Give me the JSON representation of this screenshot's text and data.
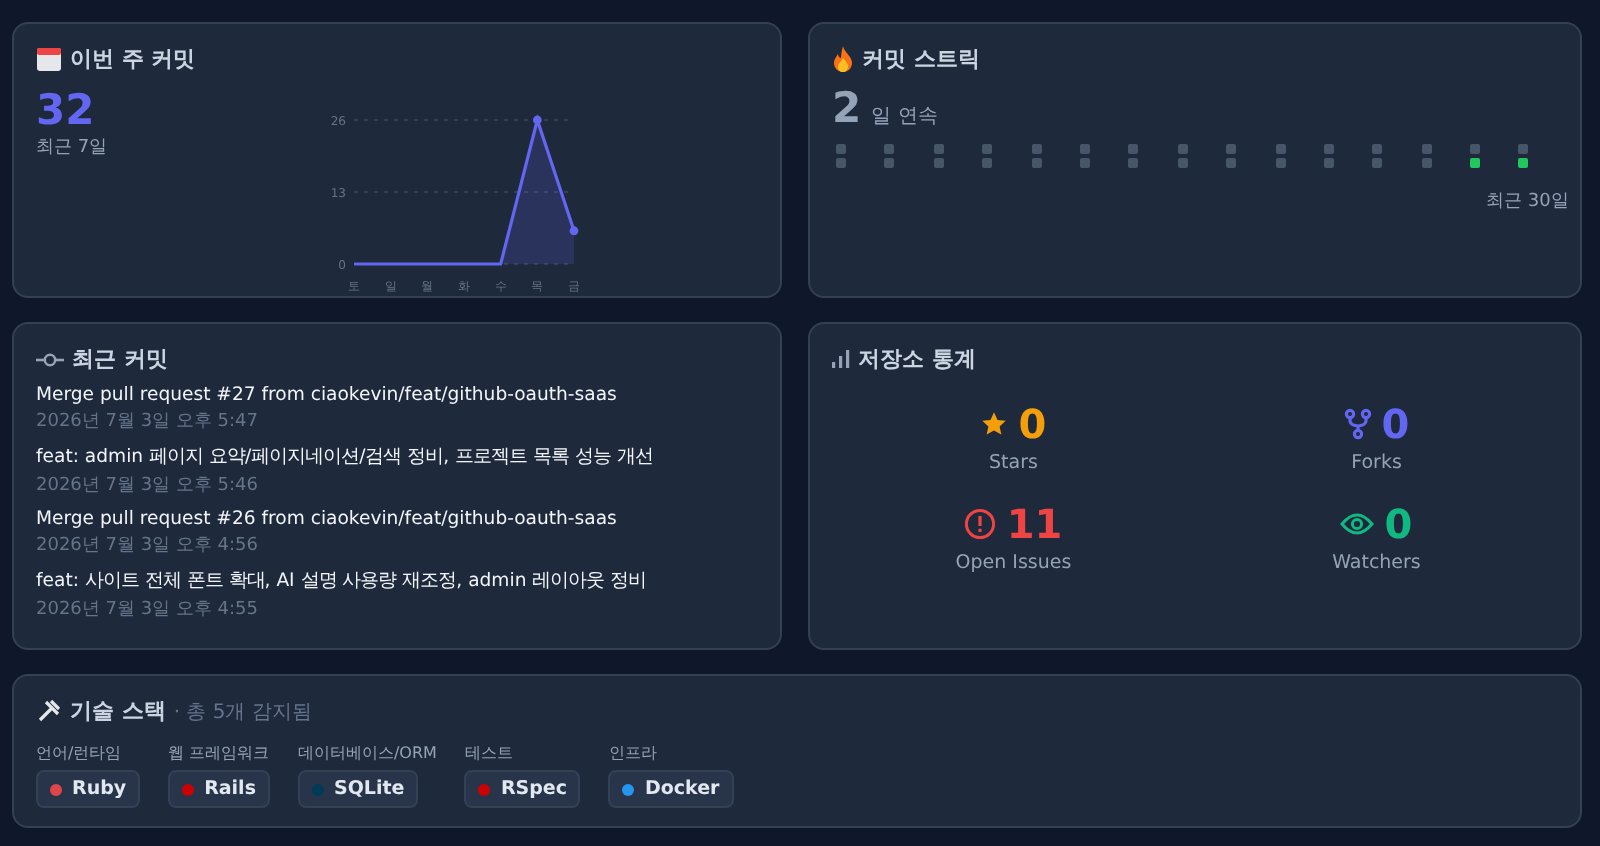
{
  "weekly": {
    "title": "이번 주 커밋",
    "count": "32",
    "caption": "최근 7일",
    "chart_data": {
      "type": "line",
      "categories": [
        "토",
        "일",
        "월",
        "화",
        "수",
        "목",
        "금"
      ],
      "series": [
        {
          "color": "#6366f1",
          "values": [
            0,
            0,
            0,
            0,
            0,
            26,
            6
          ]
        }
      ],
      "ylim": [
        0,
        26
      ],
      "yticks": [
        0,
        13,
        26
      ]
    }
  },
  "streak": {
    "title": "커밋 스트릭",
    "count": "2",
    "unit": "일 연속",
    "caption": "최근 30일",
    "days": [
      {
        "active": false
      },
      {
        "active": false
      },
      {
        "active": false
      },
      {
        "active": false
      },
      {
        "active": false
      },
      {
        "active": false
      },
      {
        "active": false
      },
      {
        "active": false
      },
      {
        "active": false
      },
      {
        "active": false
      },
      {
        "active": false
      },
      {
        "active": false
      },
      {
        "active": false
      },
      {
        "active": false
      },
      {
        "active": false
      },
      {
        "active": false
      },
      {
        "active": false
      },
      {
        "active": false
      },
      {
        "active": false
      },
      {
        "active": false
      },
      {
        "active": false
      },
      {
        "active": false
      },
      {
        "active": false
      },
      {
        "active": false
      },
      {
        "active": false
      },
      {
        "active": false
      },
      {
        "active": false
      },
      {
        "active": true
      },
      {
        "active": false
      },
      {
        "active": true
      }
    ]
  },
  "recent": {
    "title": "최근 커밋",
    "commits": [
      {
        "message": "Merge pull request #27 from ciaokevin/feat/github-oauth-saas",
        "time": "2026년 7월 3일 오후 5:47"
      },
      {
        "message": "feat: admin 페이지 요약/페이지네이션/검색 정비, 프로젝트 목록 성능 개선",
        "time": "2026년 7월 3일 오후 5:46"
      },
      {
        "message": "Merge pull request #26 from ciaokevin/feat/github-oauth-saas",
        "time": "2026년 7월 3일 오후 4:56"
      },
      {
        "message": "feat: 사이트 전체 폰트 확대, AI 설명 사용량 재조정, admin 레이아웃 정비",
        "time": "2026년 7월 3일 오후 4:55"
      }
    ]
  },
  "stats": {
    "title": "저장소 통계",
    "items": [
      {
        "kind": "star",
        "value": "0",
        "label": "Stars",
        "color": "#f59e0b"
      },
      {
        "kind": "fork",
        "value": "0",
        "label": "Forks",
        "color": "#6366f1"
      },
      {
        "kind": "issue",
        "value": "11",
        "label": "Open Issues",
        "color": "#ef4444"
      },
      {
        "kind": "eye",
        "value": "0",
        "label": "Watchers",
        "color": "#10b981"
      }
    ]
  },
  "stack": {
    "title": "기술 스택",
    "summary": "· 총 5개 감지됨",
    "groups": [
      {
        "label": "언어/런타임",
        "items": [
          {
            "name": "Ruby",
            "color": "#e0454a"
          }
        ]
      },
      {
        "label": "웹 프레임워크",
        "items": [
          {
            "name": "Rails",
            "color": "#cc0000"
          }
        ]
      },
      {
        "label": "데이터베이스/ORM",
        "items": [
          {
            "name": "SQLite",
            "color": "#003b57"
          }
        ]
      },
      {
        "label": "테스트",
        "items": [
          {
            "name": "RSpec",
            "color": "#cc0000"
          }
        ]
      },
      {
        "label": "인프라",
        "items": [
          {
            "name": "Docker",
            "color": "#2496ed"
          }
        ]
      }
    ]
  }
}
